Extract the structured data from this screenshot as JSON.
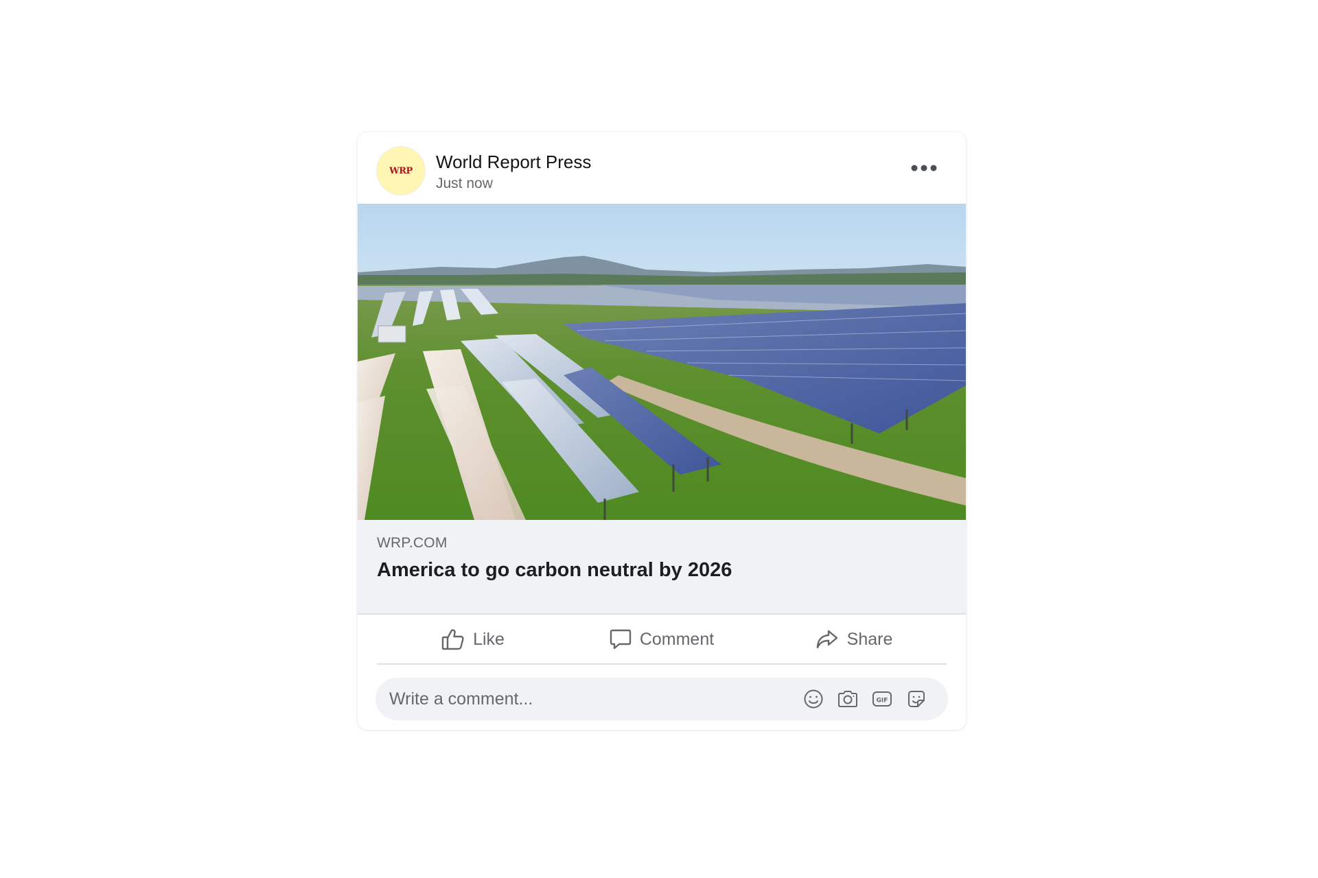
{
  "post": {
    "author": {
      "avatar_text": "WRP",
      "name": "World Report Press"
    },
    "timestamp": "Just now",
    "more_icon": "more-horizontal-icon",
    "image": {
      "subject": "solar-panel-farm-photo"
    },
    "link_preview": {
      "domain": "WRP.COM",
      "title": "America to go carbon neutral by 2026"
    },
    "actions": [
      {
        "icon": "thumbs-up-icon",
        "label": "Like"
      },
      {
        "icon": "comment-bubble-icon",
        "label": "Comment"
      },
      {
        "icon": "share-arrow-icon",
        "label": "Share"
      }
    ],
    "comment_box": {
      "placeholder": "Write a comment...",
      "value": "",
      "tools": [
        "emoji-icon",
        "camera-icon",
        "gif-icon",
        "sticker-icon"
      ]
    }
  },
  "colors": {
    "avatar_bg": "#fff6b3",
    "avatar_text": "#b0161f",
    "secondary_text": "#65676b",
    "preview_bg": "#f0f2f5",
    "divider": "#dcdfe3"
  }
}
